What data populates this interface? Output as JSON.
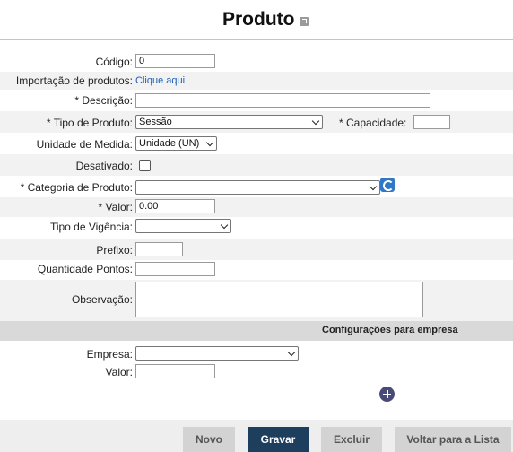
{
  "header": {
    "title": "Produto",
    "popout_icon": "external-link-icon"
  },
  "form": {
    "codigo": {
      "label": "Código:",
      "value": "0"
    },
    "importacao": {
      "label": "Importação de produtos:",
      "link": "Clique aqui"
    },
    "descricao": {
      "label": "* Descrição:",
      "value": ""
    },
    "tipo_produto": {
      "label": "* Tipo de Produto:",
      "value": "Sessão"
    },
    "capacidade": {
      "label": "* Capacidade:",
      "value": ""
    },
    "unidade_medida": {
      "label": "Unidade de Medida:",
      "value": "Unidade (UN)"
    },
    "desativado": {
      "label": "Desativado:",
      "checked": false
    },
    "categoria": {
      "label": "* Categoria de Produto:",
      "value": "",
      "refresh_icon": "refresh-icon"
    },
    "valor": {
      "label": "* Valor:",
      "value": "0.00"
    },
    "tipo_vigencia": {
      "label": "Tipo de Vigência:",
      "value": ""
    },
    "prefixo": {
      "label": "Prefixo:",
      "value": ""
    },
    "quantidade_pontos": {
      "label": "Quantidade Pontos:",
      "value": ""
    },
    "observacao": {
      "label": "Observação:",
      "value": ""
    }
  },
  "empresa_section": {
    "title": "Configurações para empresa",
    "empresa": {
      "label": "Empresa:",
      "value": ""
    },
    "valor": {
      "label": "Valor:",
      "value": ""
    },
    "add_icon": "plus-circle-icon"
  },
  "footer": {
    "novo": "Novo",
    "gravar": "Gravar",
    "excluir": "Excluir",
    "voltar": "Voltar para a Lista"
  },
  "colors": {
    "primary_button": "#1d3e5c",
    "link": "#1a5fb4",
    "section_bar": "#d9d9d9"
  }
}
